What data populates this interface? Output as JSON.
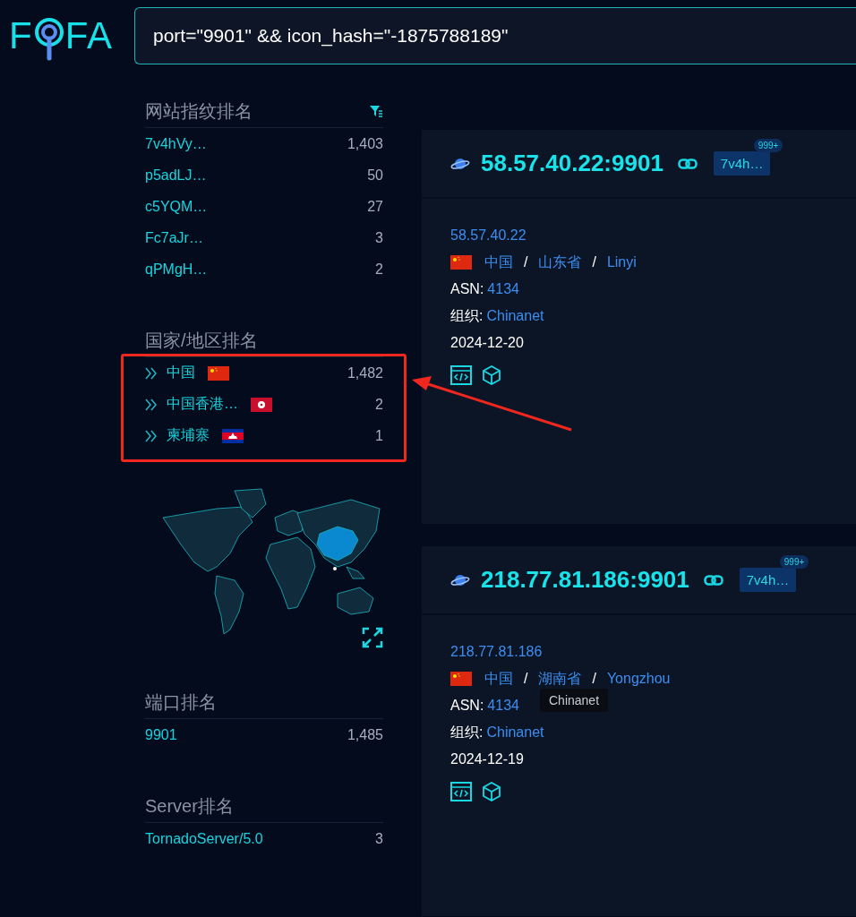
{
  "logo": {
    "before": "F",
    "after": "FA"
  },
  "search": {
    "value": "port=\"9901\" && icon_hash=\"-1875788189\""
  },
  "sidebar": {
    "sections": [
      {
        "kind": "plain",
        "title": "网站指纹排名",
        "filter": true,
        "items": [
          {
            "name": "7v4hVy…",
            "count": "1,403"
          },
          {
            "name": "p5adLJ…",
            "count": "50"
          },
          {
            "name": "c5YQM…",
            "count": "27"
          },
          {
            "name": "Fc7aJr…",
            "count": "3"
          },
          {
            "name": "qPMgH…",
            "count": "2"
          }
        ]
      },
      {
        "kind": "country",
        "title": "国家/地区排名",
        "highlighted": true,
        "items": [
          {
            "name": "中国",
            "flag": {
              "kind": "cn"
            },
            "count": "1,482"
          },
          {
            "name": "中国香港…",
            "flag": {
              "kind": "hk"
            },
            "count": "2"
          },
          {
            "name": "柬埔寨",
            "flag": {
              "kind": "kh"
            },
            "count": "1"
          }
        ]
      },
      {
        "kind": "map"
      },
      {
        "kind": "plain",
        "title": "端口排名",
        "items": [
          {
            "name": "9901",
            "count": "1,485"
          }
        ]
      },
      {
        "kind": "plain",
        "title": "Server排名",
        "items": [
          {
            "name": "TornadoServer/5.0",
            "count": "3"
          }
        ]
      }
    ]
  },
  "results": [
    {
      "host": "58.57.40.22:9901",
      "tag": "7v4h…",
      "badge": "999+",
      "ip": "58.57.40.22",
      "flag": {
        "kind": "cn"
      },
      "location": [
        "中国",
        "山东省",
        "Linyi"
      ],
      "asn_label": "ASN:",
      "asn": "4134",
      "org_label": "组织:",
      "org": "Chinanet",
      "date": "2024-12-20"
    },
    {
      "host": "218.77.81.186:9901",
      "tag": "7v4h…",
      "badge": "999+",
      "ip": "218.77.81.186",
      "flag": {
        "kind": "cn"
      },
      "location": [
        "中国",
        "湖南省",
        "Yongzhou"
      ],
      "asn_label": "ASN:",
      "asn": "4134",
      "org_label": "组织:",
      "org": "Chinanet",
      "date": "2024-12-19",
      "tooltip": "Chinanet"
    }
  ],
  "location_separator": "/",
  "annotation": {
    "arrow": true
  }
}
